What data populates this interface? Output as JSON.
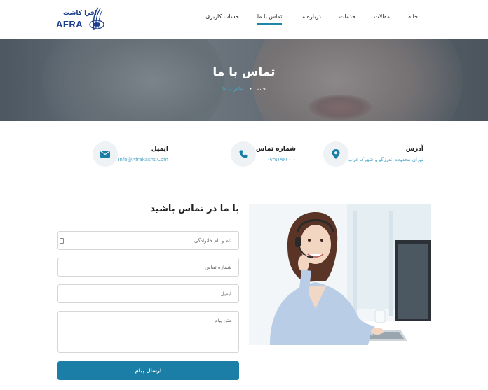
{
  "logo": {
    "latin": "AFRA",
    "persian": "افرا کاشت"
  },
  "nav": {
    "items": [
      {
        "label": "خانه",
        "active": false
      },
      {
        "label": "مقالات",
        "active": false
      },
      {
        "label": "خدمات",
        "active": false
      },
      {
        "label": "درباره ما",
        "active": false
      },
      {
        "label": "تماس با ما",
        "active": true
      },
      {
        "label": "حساب کاربری",
        "active": false
      }
    ]
  },
  "hero": {
    "title": "تماس با ما",
    "breadcrumb": {
      "home": "خانه",
      "separator": "•",
      "current": "تماس با ما"
    }
  },
  "contact": {
    "address": {
      "title": "آدرس",
      "value": "تهران محدوده اندرزگو و شهرک غرب",
      "icon": "map-pin-icon"
    },
    "phone": {
      "title": "شماره تماس",
      "value": "۰۹۳۵۱۹۶۶۰۰۰",
      "icon": "phone-icon"
    },
    "email": {
      "title": "ایمیل",
      "value": "Info@Afrakasht.Com",
      "icon": "envelope-icon"
    }
  },
  "form": {
    "title": "با ما در تماس باشید",
    "name_placeholder": "نام و نام خانوادگی",
    "phone_placeholder": "شماره تماس",
    "email_placeholder": "ایمیل",
    "message_placeholder": "متن پیام",
    "submit_label": "ارسال پیام"
  },
  "colors": {
    "accent": "#1a7ea6",
    "link": "#4aa6c6",
    "icon_bg": "#eef2f5"
  }
}
